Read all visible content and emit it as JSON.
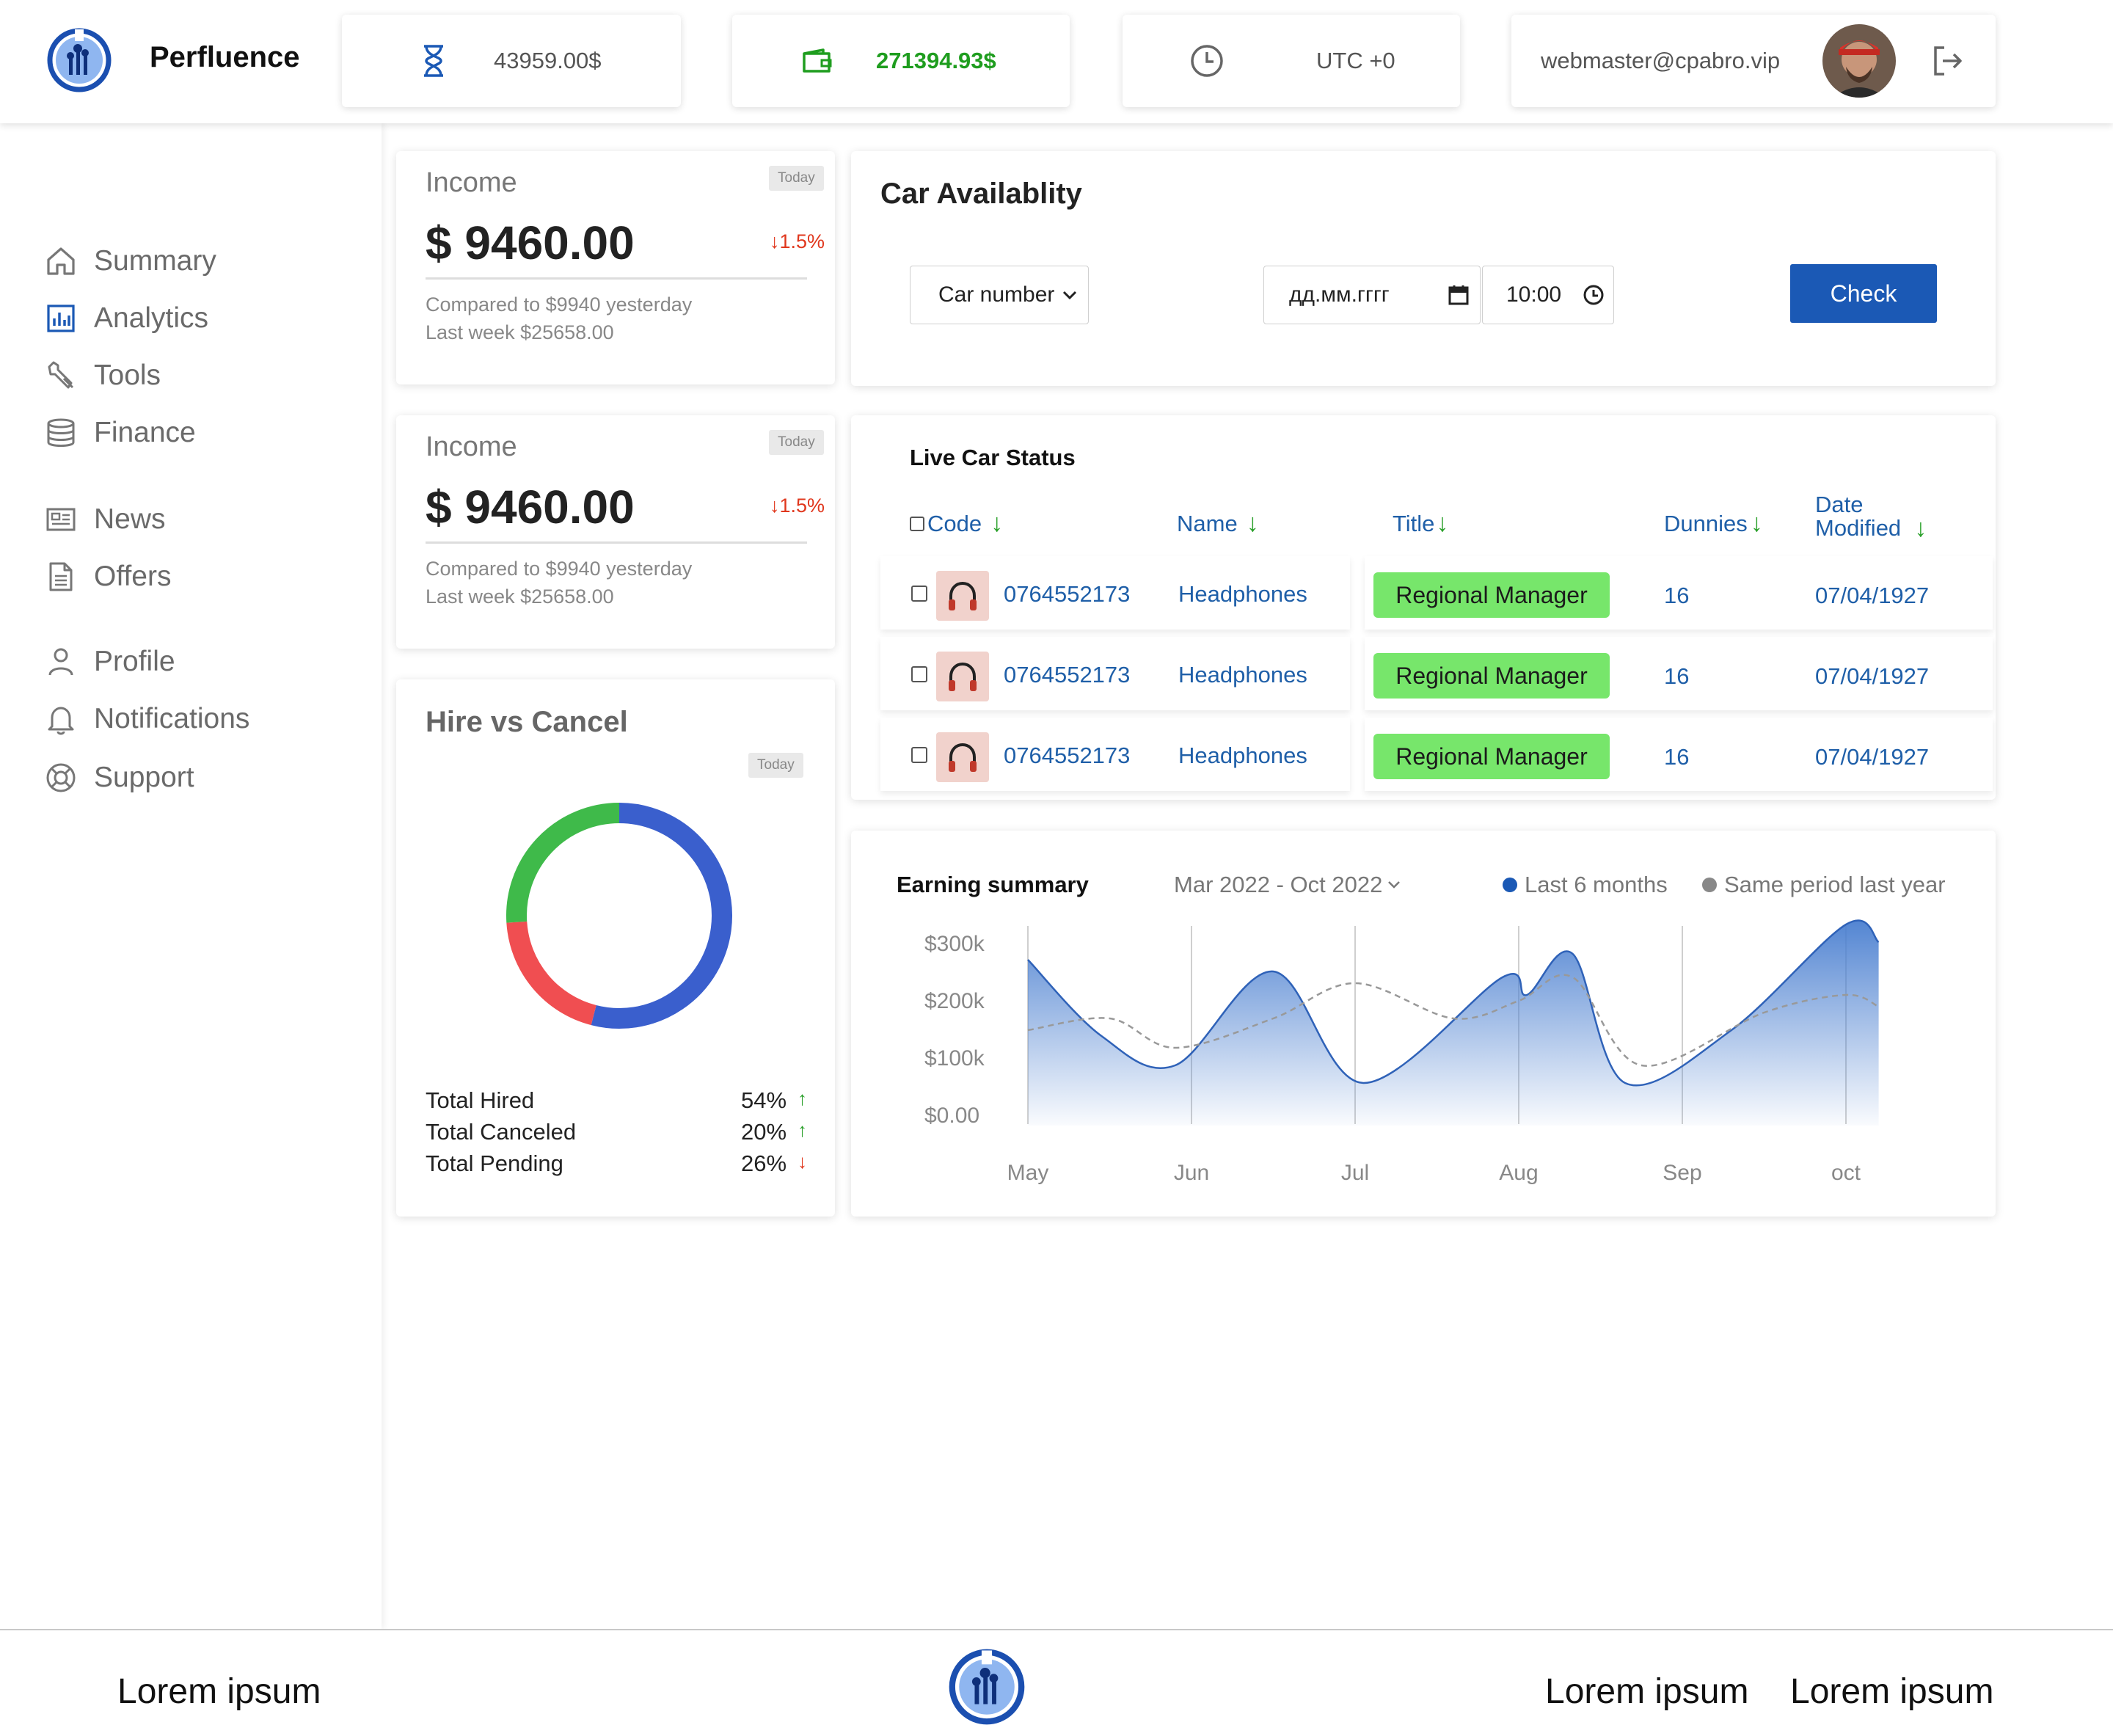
{
  "brand": {
    "name": "Perfluence"
  },
  "header": {
    "timer_value": "43959.00$",
    "wallet_value": "271394.93$",
    "timezone": "UTC +0",
    "email": "webmaster@cpabro.vip"
  },
  "sidebar": {
    "items": [
      {
        "label": "Summary",
        "icon": "home-icon"
      },
      {
        "label": "Analytics",
        "icon": "bar-chart-icon"
      },
      {
        "label": "Tools",
        "icon": "wrench-icon"
      },
      {
        "label": "Finance",
        "icon": "database-icon"
      },
      {
        "label": "News",
        "icon": "newspaper-icon"
      },
      {
        "label": "Offers",
        "icon": "document-icon"
      },
      {
        "label": "Profile",
        "icon": "user-icon"
      },
      {
        "label": "Notifications",
        "icon": "bell-icon"
      },
      {
        "label": "Support",
        "icon": "lifebuoy-icon"
      }
    ]
  },
  "income_cards": [
    {
      "title": "Income",
      "badge": "Today",
      "amount": "$ 9460.00",
      "change": "1.5%",
      "compared": "Compared to $9940 yesterday",
      "last_week": "Last week $25658.00"
    },
    {
      "title": "Income",
      "badge": "Today",
      "amount": "$ 9460.00",
      "change": "1.5%",
      "compared": "Compared to $9940 yesterday",
      "last_week": "Last week $25658.00"
    }
  ],
  "hire_vs_cancel": {
    "title": "Hire vs Cancel",
    "badge": "Today",
    "rows": [
      {
        "label": "Total Hired",
        "value": "54%",
        "trend": "up"
      },
      {
        "label": "Total Canceled",
        "value": "20%",
        "trend": "up"
      },
      {
        "label": "Total Pending",
        "value": "26%",
        "trend": "down"
      }
    ],
    "segments": [
      {
        "name": "Total Hired",
        "percent": 54,
        "color": "#3a5fcd"
      },
      {
        "name": "Total Canceled",
        "percent": 20,
        "color": "#f04e51"
      },
      {
        "name": "Total Pending",
        "percent": 26,
        "color": "#3fba4a"
      }
    ]
  },
  "car_availability": {
    "title": "Car Availablity",
    "select_value": "Car number",
    "date_placeholder": "дд.мм.гггг",
    "time_value": "10:00",
    "check_label": "Check"
  },
  "live_status": {
    "title": "Live Car Status",
    "columns": [
      "Code",
      "Name",
      "Title",
      "Dunnies",
      "Date",
      "Modified"
    ],
    "rows": [
      {
        "code": "0764552173",
        "name": "Headphones",
        "title": "Regional Manager",
        "dunnies": "16",
        "date": "07/04/1927"
      },
      {
        "code": "0764552173",
        "name": "Headphones",
        "title": "Regional Manager",
        "dunnies": "16",
        "date": "07/04/1927"
      },
      {
        "code": "0764552173",
        "name": "Headphones",
        "title": "Regional Manager",
        "dunnies": "16",
        "date": "07/04/1927"
      }
    ]
  },
  "earning_summary": {
    "title": "Earning summary",
    "range": "Mar 2022 - Oct 2022",
    "legend": [
      {
        "label": "Last 6 months",
        "color": "#1b59b5"
      },
      {
        "label": "Same period last year",
        "color": "#888888"
      }
    ]
  },
  "chart_data": {
    "type": "area",
    "x": [
      "May",
      "Jun",
      "Jul",
      "Aug",
      "Sep",
      "oct"
    ],
    "yticks": [
      "$300k",
      "$200k",
      "$100k",
      "$0.00"
    ],
    "ylim": [
      0,
      300000
    ],
    "series": [
      {
        "name": "Last 6 months",
        "points": [
          [
            0,
            270000
          ],
          [
            0.45,
            140000
          ],
          [
            0.9,
            90000
          ],
          [
            1.5,
            250000
          ],
          [
            2.05,
            60000
          ],
          [
            2.9,
            240000
          ],
          [
            3.05,
            210000
          ],
          [
            3.33,
            280000
          ],
          [
            3.65,
            60000
          ],
          [
            4.3,
            150000
          ],
          [
            5.0,
            330000
          ],
          [
            5.2,
            300000
          ]
        ]
      },
      {
        "name": "Same period last year",
        "points": [
          [
            0,
            150000
          ],
          [
            0.5,
            170000
          ],
          [
            0.9,
            120000
          ],
          [
            1.5,
            170000
          ],
          [
            2.0,
            230000
          ],
          [
            2.6,
            170000
          ],
          [
            3.0,
            200000
          ],
          [
            3.33,
            240000
          ],
          [
            3.75,
            90000
          ],
          [
            4.5,
            180000
          ],
          [
            5.0,
            210000
          ],
          [
            5.2,
            190000
          ]
        ]
      }
    ],
    "grid": "vertical"
  },
  "footer": {
    "links": [
      "Lorem ipsum",
      "Lorem ipsum",
      "Lorem ipsum"
    ]
  }
}
